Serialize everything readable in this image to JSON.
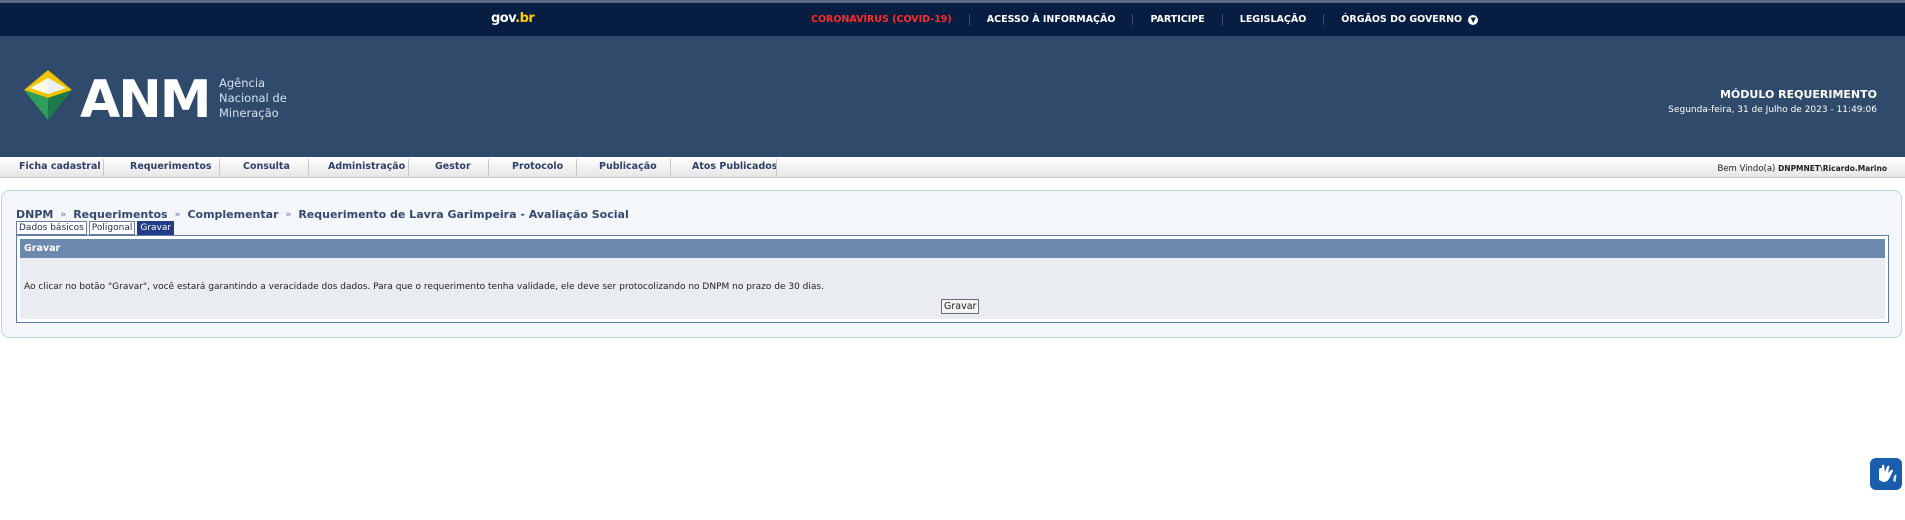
{
  "govbar": {
    "logo_gov": "gov",
    "logo_br": ".br",
    "links": [
      {
        "label": "CORONAVÍRUS (COVID-19)"
      },
      {
        "label": "ACESSO À INFORMAÇÃO"
      },
      {
        "label": "PARTICIPE"
      },
      {
        "label": "LEGISLAÇÃO"
      },
      {
        "label": "ÓRGÃOS DO GOVERNO"
      }
    ],
    "chevron_icon": "chevron-down-icon",
    "covid_color": "#ff2a2a"
  },
  "header": {
    "logo_text": "ANM",
    "logo_sub_1": "Agência",
    "logo_sub_2": "Nacional de",
    "logo_sub_3": "Mineração",
    "module_title": "MÓDULO REQUERIMENTO",
    "datetime": "Segunda-feira, 31 de Julho de 2023 - 11:49:06",
    "background": "#2f4a6a"
  },
  "nav": {
    "items": [
      {
        "label": "Ficha cadastral"
      },
      {
        "label": "Requerimentos"
      },
      {
        "label": "Consulta"
      },
      {
        "label": "Administração"
      },
      {
        "label": "Gestor"
      },
      {
        "label": "Protocolo"
      },
      {
        "label": "Publicação"
      },
      {
        "label": "Atos Publicados"
      }
    ],
    "welcome_label": "Bem Vindo(a)",
    "welcome_user": "DNPMNET\\Ricardo.Marino"
  },
  "breadcrumb": {
    "items": [
      "DNPM",
      "Requerimentos",
      "Complementar",
      "Requerimento de Lavra Garimpeira - Avaliação Social"
    ],
    "separator": "»"
  },
  "tabs": [
    {
      "label": "Dados básicos",
      "active": false
    },
    {
      "label": "Poligonal",
      "active": false
    },
    {
      "label": "Gravar",
      "active": true
    }
  ],
  "form": {
    "title": "Gravar",
    "message": "Ao clicar no botão \"Gravar\", você estará garantindo a veracidade dos dados. Para que o requerimento tenha validade, ele deve ser protocolizando no DNPM no prazo de 30 dias.",
    "button_label": "Gravar"
  },
  "accessibility": {
    "icon": "sign-language-hands-icon"
  }
}
